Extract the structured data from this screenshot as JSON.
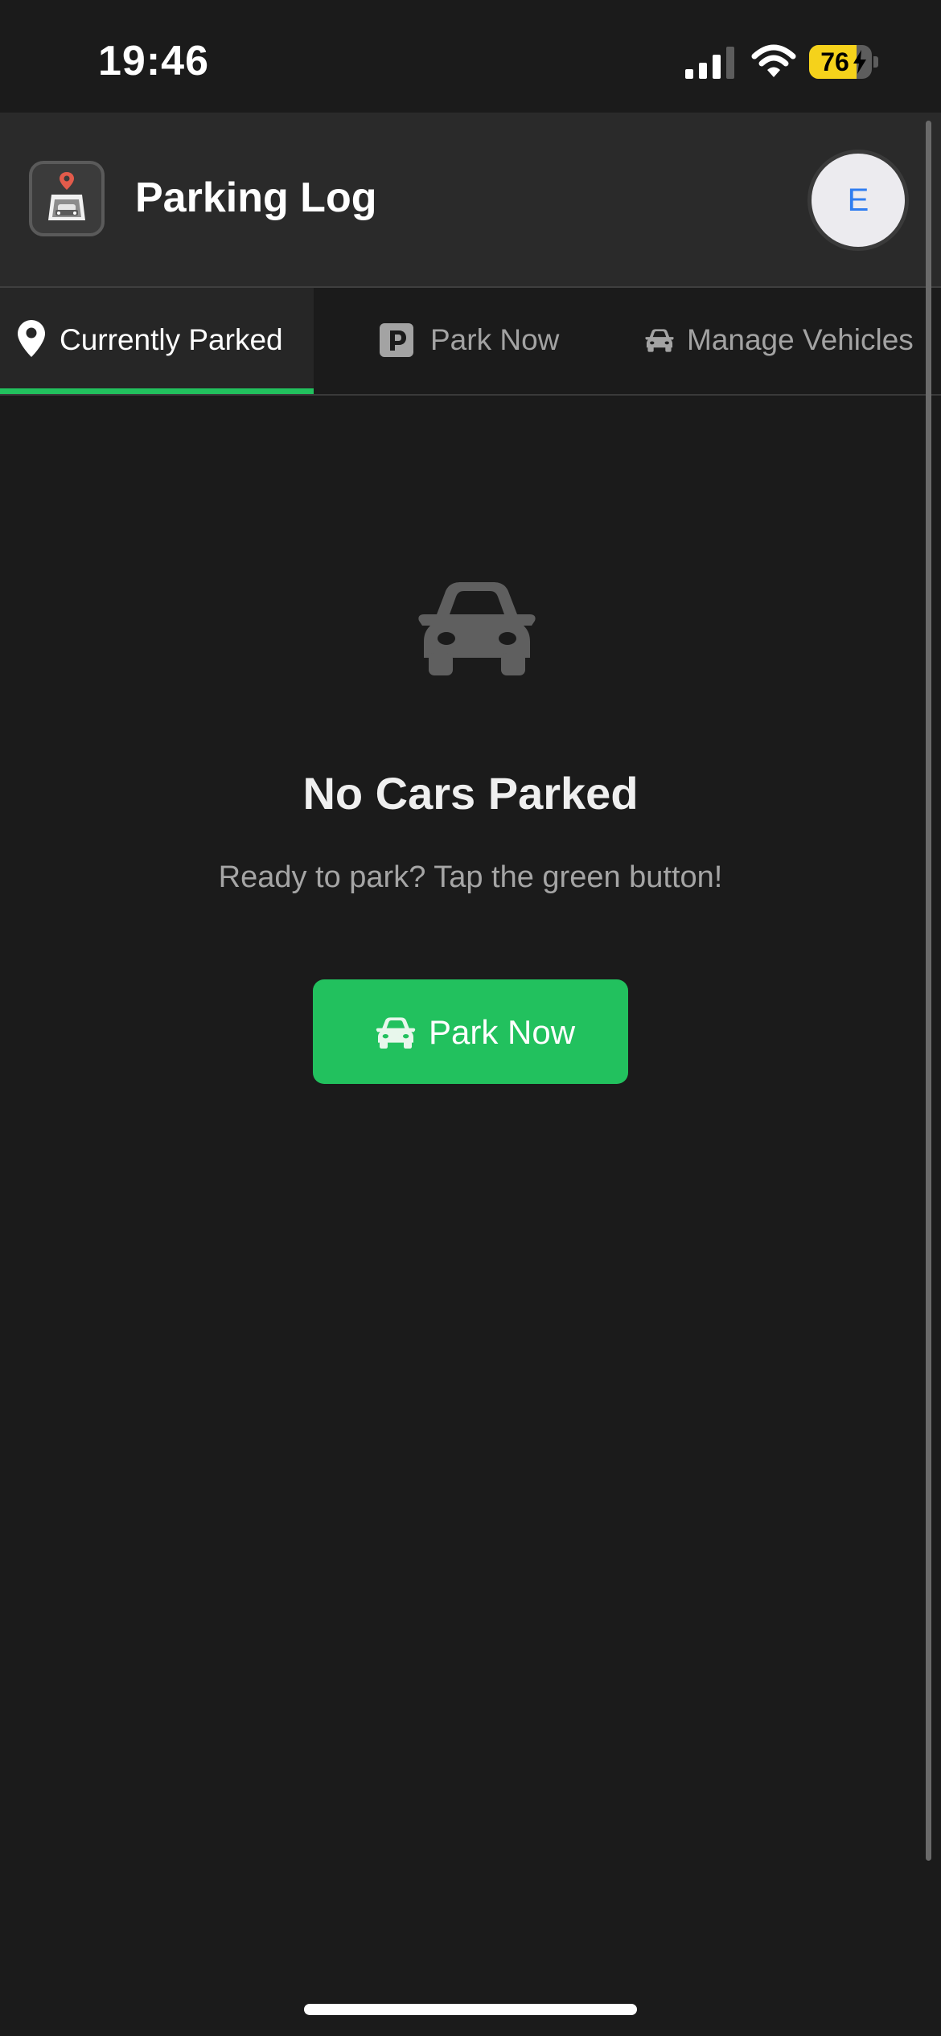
{
  "status_bar": {
    "time": "19:46",
    "battery_percent": "76",
    "battery_level": 0.76,
    "charging": true
  },
  "header": {
    "title": "Parking Log",
    "avatar_initial": "E"
  },
  "tabs": [
    {
      "label": "Currently Parked",
      "icon": "map-pin-icon",
      "active": true
    },
    {
      "label": "Park Now",
      "icon": "parking-sign-icon",
      "active": false
    },
    {
      "label": "Manage Vehicles",
      "icon": "car-icon",
      "active": false
    }
  ],
  "empty_state": {
    "icon": "car-icon",
    "title": "No Cars Parked",
    "subtitle": "Ready to park? Tap the green button!",
    "button_label": "Park Now",
    "button_icon": "car-icon"
  },
  "colors": {
    "background": "#1b1b1b",
    "header": "#2a2a2a",
    "accent_green": "#22c15e",
    "avatar_text": "#2f7df0",
    "battery": "#f5d21b"
  }
}
